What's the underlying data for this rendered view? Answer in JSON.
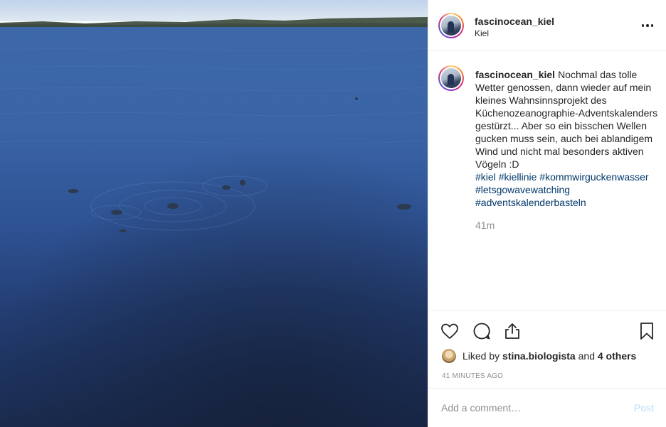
{
  "post": {
    "username": "fascinocean_kiel",
    "location": "Kiel",
    "caption_text": "Nochmal das tolle Wetter genossen, dann wieder auf mein kleines Wahnsinnsprojekt des Küchenozeanographie-Adventskalenders gestürzt... Aber so ein bisschen Wellen gucken muss sein, auch bei ablandigem Wind und nicht mal besonders aktiven Vögeln :D",
    "hashtags": [
      "#kiel",
      "#kiellinie",
      "#kommwirguckenwasser",
      "#letsgowavewatching",
      "#adventskalenderbasteln"
    ],
    "caption_time": "41m"
  },
  "likes": {
    "prefix": "Liked by",
    "user": "stina.biologista",
    "conjunction": "and",
    "others": "4 others"
  },
  "timestamp": "41 minutes ago",
  "comment": {
    "placeholder": "Add a comment…",
    "post_label": "Post",
    "post_color": "#b2dffc"
  },
  "icons": [
    "more-options-icon",
    "heart-icon",
    "comment-icon",
    "share-icon",
    "bookmark-icon"
  ]
}
